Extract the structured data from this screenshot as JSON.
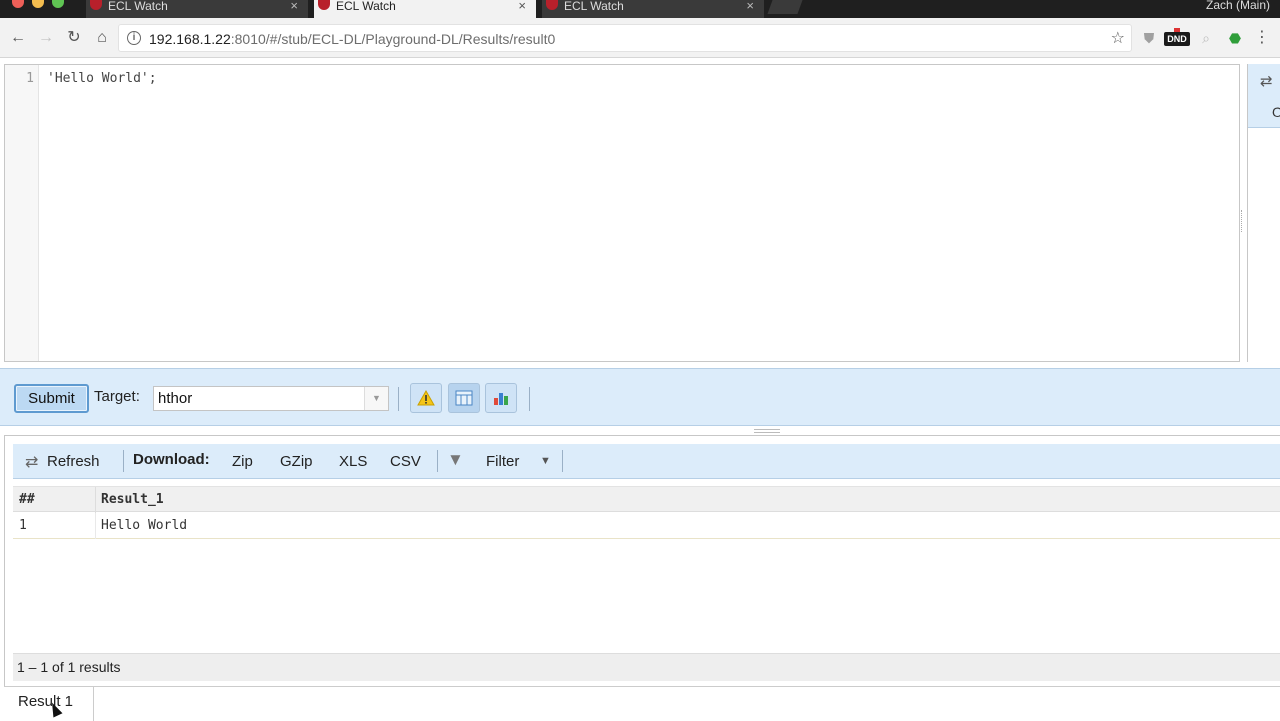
{
  "browser": {
    "tabs": [
      {
        "title": "ECL Watch",
        "active": false
      },
      {
        "title": "ECL Watch",
        "active": true
      },
      {
        "title": "ECL Watch",
        "active": false
      }
    ],
    "profile": "Zach (Main)",
    "url_host": "192.168.1.22",
    "url_rest": ":8010/#/stub/ECL-DL/Playground-DL/Results/result0",
    "dnd_label": "DND"
  },
  "editor": {
    "line_number": "1",
    "code": "'Hello World';",
    "side_label": "O"
  },
  "toolbar": {
    "submit_label": "Submit",
    "target_label": "Target:",
    "target_value": "hthor"
  },
  "results": {
    "refresh_label": "Refresh",
    "download_label": "Download:",
    "zip_label": "Zip",
    "gzip_label": "GZip",
    "xls_label": "XLS",
    "csv_label": "CSV",
    "filter_label": "Filter",
    "columns": [
      "##",
      "Result_1"
    ],
    "rows": [
      [
        "1",
        "Hello World"
      ]
    ],
    "count_text": "1 – 1 of 1 results",
    "tab_label": "Result 1"
  }
}
